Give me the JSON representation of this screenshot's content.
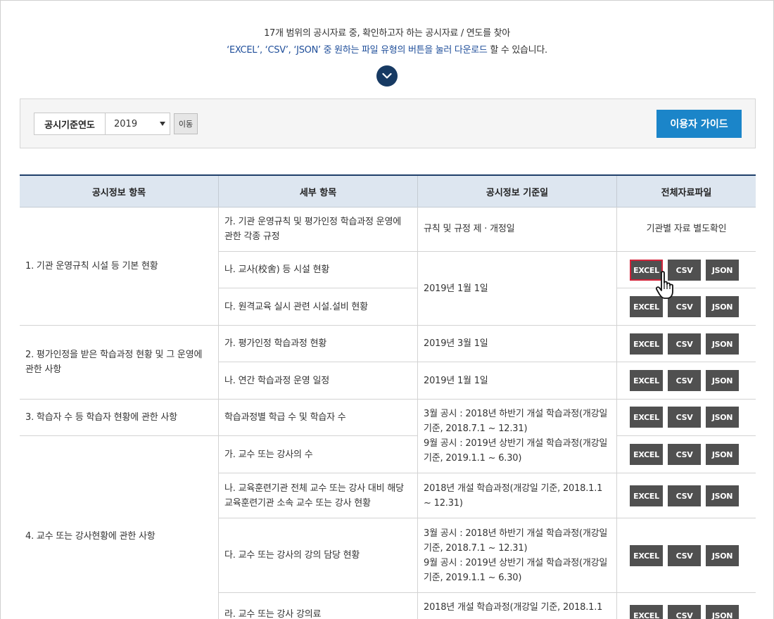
{
  "intro": {
    "line1": "17개 범위의 공시자료 중, 확인하고자 하는 공시자료 / 연도를 찾아",
    "line2_blue": "‘EXCEL’, ‘CSV’, ‘JSON’ 중 원하는 파일 유형의 버튼을 눌러 다운로드",
    "line2_rest": " 할 수 있습니다."
  },
  "search": {
    "label": "공시기준연도",
    "year_value": "2019",
    "move_button": "이동",
    "guide_button": "이용자 가이드"
  },
  "table": {
    "headers": [
      "공시정보 항목",
      "세부 항목",
      "공시정보 기준일",
      "전체자료파일"
    ],
    "categories": [
      "1. 기관 운영규칙 시설 등 기본 현황",
      "2. 평가인정을 받은 학습과정 현황 및 그 운영에 관한 사항",
      "3. 학습자 수 등 학습자 현황에 관한 사항",
      "4. 교수 또는 강사현황에 관한 사항"
    ],
    "details": [
      "가. 기관 운영규칙 및 평가인정 학습과정 운영에 관한 각종 규정",
      "나. 교사(校舍) 등 시설 현황",
      "다. 원격교육 실시 관련 시설.설비 현황",
      "가. 평가인정 학습과정 현황",
      "나. 연간 학습과정 운영 일정",
      "학습과정별 학급 수 및 학습자 수",
      "가. 교수 또는 강사의 수",
      "나. 교육훈련기관 전체 교수 또는 강사 대비 해당 교육훈련기관 소속 교수 또는 강사 현황",
      "다. 교수 또는 강사의 강의 담당 현황",
      "라. 교수 또는 강사 강의료"
    ],
    "dates": {
      "d1": "규칙 및 규정 제 · 개정일",
      "d2": "2019년 1월 1일",
      "d3": "2019년 3월 1일",
      "d4": "2019년 1월 1일",
      "d5a": "3월 공시 : 2018년 하반기 개설 학습과정(개강일 기준, 2018.7.1 ~ 12.31)",
      "d5b": "9월 공시 : 2019년 상반기 개설 학습과정(개강일 기준, 2019.1.1 ~ 6.30)",
      "d6": "2018년 개설 학습과정(개강일 기준, 2018.1.1 ~ 12.31)",
      "d7a": "3월 공시 : 2018년 하반기 개설 학습과정(개강일 기준, 2018.7.1 ~ 12.31)",
      "d7b": "9월 공시 : 2019년 상반기 개설 학습과정(개강일 기준, 2019.1.1 ~ 6.30)",
      "d8": "2018년 개설 학습과정(개강일 기준, 2018.1.1 ~"
    },
    "file_note": "기관별 자료 별도확인",
    "btn_excel": "EXCEL",
    "btn_csv": "CSV",
    "btn_json": "JSON"
  },
  "colors": {
    "accent_blue": "#1b85c9",
    "header_bg": "#dde6f0",
    "button_gray": "#505050",
    "highlight": "#d0243a"
  },
  "icons": {
    "scroll_down": "chevron-down-icon",
    "cursor": "hand-pointer-icon"
  }
}
